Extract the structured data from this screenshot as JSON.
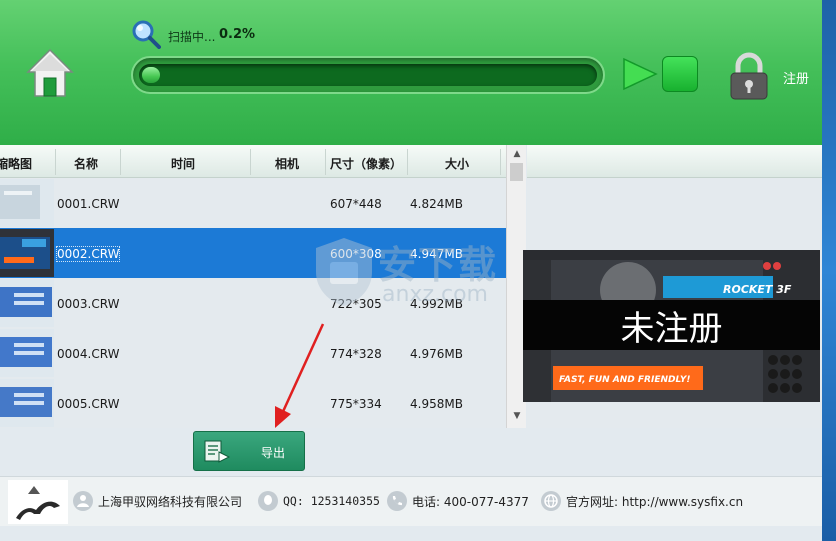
{
  "header": {
    "scan_label": "扫描中...",
    "scan_percent": "0.2%",
    "progress_fraction": 0.002,
    "register_label": "注册",
    "icons": [
      "home-icon",
      "search-icon",
      "play-icon",
      "stop-icon",
      "lock-icon"
    ]
  },
  "table": {
    "columns": [
      "缩略图",
      "名称",
      "时间",
      "相机",
      "尺寸（像素）",
      "大小"
    ],
    "rows": [
      {
        "name": "0001.CRW",
        "time": "",
        "camera": "",
        "dimensions": "607*448",
        "size": "4.824MB",
        "selected": false
      },
      {
        "name": "0002.CRW",
        "time": "",
        "camera": "",
        "dimensions": "600*308",
        "size": "4.947MB",
        "selected": true
      },
      {
        "name": "0003.CRW",
        "time": "",
        "camera": "",
        "dimensions": "722*305",
        "size": "4.992MB",
        "selected": false
      },
      {
        "name": "0004.CRW",
        "time": "",
        "camera": "",
        "dimensions": "774*328",
        "size": "4.976MB",
        "selected": false
      },
      {
        "name": "0005.CRW",
        "time": "",
        "camera": "",
        "dimensions": "775*334",
        "size": "4.958MB",
        "selected": false
      }
    ]
  },
  "preview": {
    "overlay_text": "未注册",
    "banner_text": "FAST, FUN AND FRIENDLY!",
    "product_text": "ROCKET 3F"
  },
  "export_button": {
    "label": "导出"
  },
  "watermark": {
    "text": "安下载",
    "url": "anxz.com"
  },
  "footer": {
    "company": "上海甲驭网络科技有限公司",
    "qq": "QQ: 1253140355",
    "phone": "电话: 400-077-4377",
    "website": "官方网址: http://www.sysfix.cn"
  },
  "colors": {
    "header_green": "#45c05a",
    "selected_row": "#1c7ad6",
    "export_button": "#2a9a6e"
  }
}
